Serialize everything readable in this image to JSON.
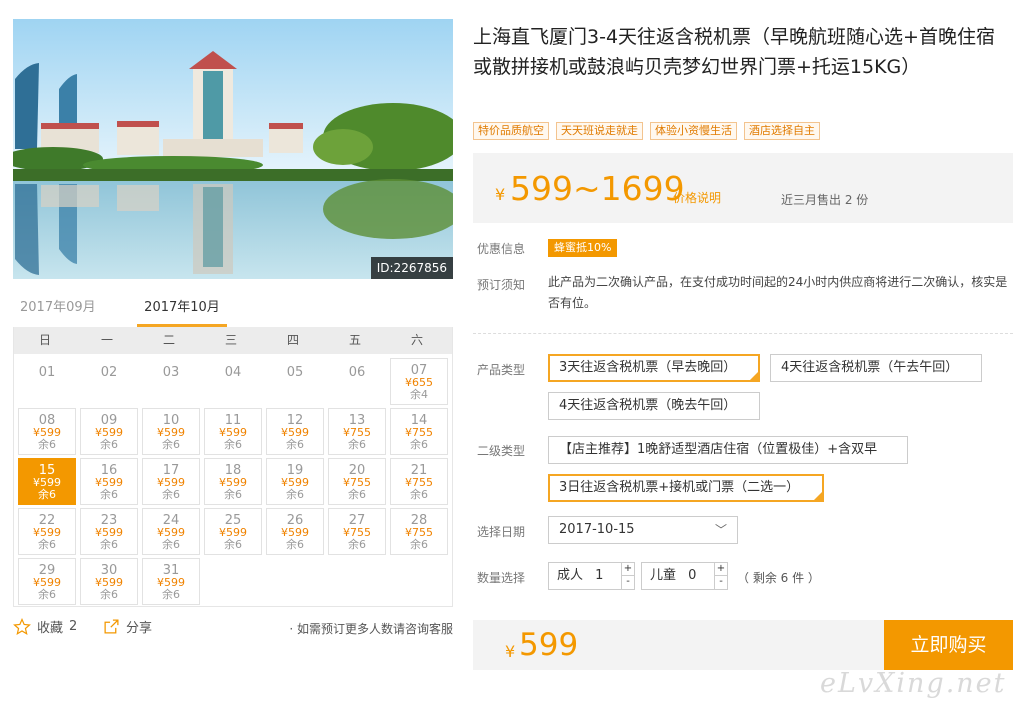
{
  "photo": {
    "id_label": "ID:2267856"
  },
  "calendar": {
    "tabs": [
      "2017年09月",
      "2017年10月"
    ],
    "weekdays": [
      "日",
      "一",
      "二",
      "三",
      "四",
      "五",
      "六"
    ],
    "row0": [
      "01",
      "02",
      "03",
      "04",
      "05",
      "06"
    ],
    "days": [
      {
        "d": "07",
        "p": "¥655",
        "s": "余4"
      },
      {
        "d": "08",
        "p": "¥599",
        "s": "余6"
      },
      {
        "d": "09",
        "p": "¥599",
        "s": "余6"
      },
      {
        "d": "10",
        "p": "¥599",
        "s": "余6"
      },
      {
        "d": "11",
        "p": "¥599",
        "s": "余6"
      },
      {
        "d": "12",
        "p": "¥599",
        "s": "余6"
      },
      {
        "d": "13",
        "p": "¥755",
        "s": "余6"
      },
      {
        "d": "14",
        "p": "¥755",
        "s": "余6"
      },
      {
        "d": "15",
        "p": "¥599",
        "s": "余6"
      },
      {
        "d": "16",
        "p": "¥599",
        "s": "余6"
      },
      {
        "d": "17",
        "p": "¥599",
        "s": "余6"
      },
      {
        "d": "18",
        "p": "¥599",
        "s": "余6"
      },
      {
        "d": "19",
        "p": "¥599",
        "s": "余6"
      },
      {
        "d": "20",
        "p": "¥755",
        "s": "余6"
      },
      {
        "d": "21",
        "p": "¥755",
        "s": "余6"
      },
      {
        "d": "22",
        "p": "¥599",
        "s": "余6"
      },
      {
        "d": "23",
        "p": "¥599",
        "s": "余6"
      },
      {
        "d": "24",
        "p": "¥599",
        "s": "余6"
      },
      {
        "d": "25",
        "p": "¥599",
        "s": "余6"
      },
      {
        "d": "26",
        "p": "¥599",
        "s": "余6"
      },
      {
        "d": "27",
        "p": "¥755",
        "s": "余6"
      },
      {
        "d": "28",
        "p": "¥755",
        "s": "余6"
      },
      {
        "d": "29",
        "p": "¥599",
        "s": "余6"
      },
      {
        "d": "30",
        "p": "¥599",
        "s": "余6"
      },
      {
        "d": "31",
        "p": "¥599",
        "s": "余6"
      }
    ]
  },
  "footer_left": {
    "fav_label": "收藏",
    "fav_count": "2",
    "share_label": "分享",
    "consult": "· 如需预订更多人数请咨询客服"
  },
  "product": {
    "title": "上海直飞厦门3-4天往返含税机票（早晚航班随心选+首晚住宿或散拼接机或鼓浪屿贝壳梦幻世界门票+托运15KG）",
    "tags": [
      "特价品质航空",
      "天天班说走就走",
      "体验小资慢生活",
      "酒店选择自主"
    ],
    "currency": "¥",
    "price_range": "599~1699",
    "price_note": "价格说明",
    "sold": "近三月售出 2 份",
    "promo_label": "优惠信息",
    "promo": "蜂蜜抵10%",
    "notice_label": "预订须知",
    "notice": "此产品为二次确认产品，在支付成功时间起的24小时内供应商将进行二次确认，核实是否有位。",
    "type_label": "产品类型",
    "types": [
      "3天往返含税机票（早去晚回）",
      "4天往返含税机票（午去午回）",
      "4天往返含税机票（晚去午回）"
    ],
    "sub_label": "二级类型",
    "subs": [
      "【店主推荐】1晚舒适型酒店住宿（位置极佳）+含双早",
      "3日往返含税机票+接机或门票（二选一）"
    ],
    "date_label": "选择日期",
    "date_value": "2017-10-15",
    "qty_label": "数量选择",
    "adult_label": "成人",
    "adult_value": "1",
    "child_label": "儿童",
    "child_value": "0",
    "remain": "（ 剩余 6 件 ）",
    "final_price": "599",
    "buy_label": "立即购买"
  },
  "watermark": "eLvXing.net",
  "colors": {
    "accent": "#f39800",
    "tag_border": "#f3c48f"
  }
}
